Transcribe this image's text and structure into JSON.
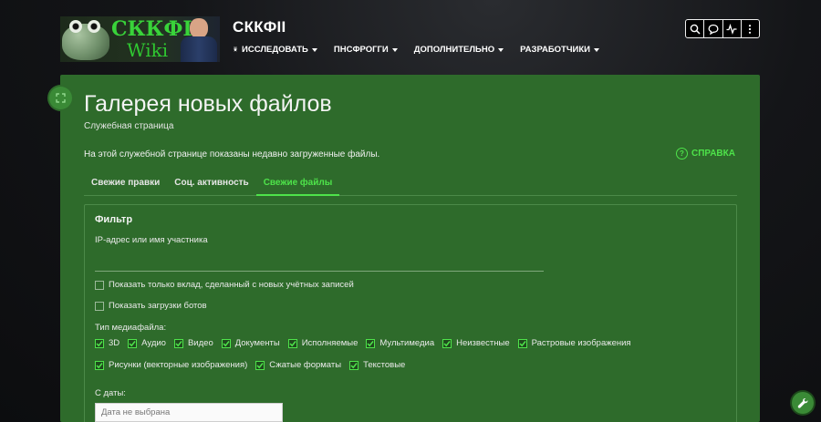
{
  "site": {
    "logo_line1": "СККФII",
    "logo_line2": "Wiki",
    "title": "СККФII"
  },
  "nav": {
    "items": [
      {
        "label": "Исследовать",
        "icon": "compass-icon"
      },
      {
        "label": "ПНСФрогги"
      },
      {
        "label": "Дополнительно"
      },
      {
        "label": "Разработчики"
      }
    ]
  },
  "toolbar": {
    "buttons": [
      "search-icon",
      "chat-icon",
      "activity-icon",
      "more-vertical-icon"
    ]
  },
  "page": {
    "title": "Галерея новых файлов",
    "subtitle": "Служебная страница",
    "intro": "На этой служебной странице показаны недавно загруженные файлы.",
    "help_label": "Справка",
    "help_icon": "?"
  },
  "tabs": [
    {
      "label": "Свежие правки",
      "active": false
    },
    {
      "label": "Соц. активность",
      "active": false
    },
    {
      "label": "Свежие файлы",
      "active": true
    }
  ],
  "filter": {
    "title": "Фильтр",
    "ip_label": "IP-адрес или имя участника",
    "ip_value": "",
    "new_accounts_label": "Показать только вклад, сделанный с новых учётных записей",
    "new_accounts_checked": false,
    "bots_label": "Показать загрузки ботов",
    "bots_checked": false,
    "media_label": "Тип медиафайла:",
    "media_types_row1": [
      {
        "label": "3D",
        "checked": true
      },
      {
        "label": "Аудио",
        "checked": true
      },
      {
        "label": "Видео",
        "checked": true
      },
      {
        "label": "Документы",
        "checked": true
      },
      {
        "label": "Исполняемые",
        "checked": true
      },
      {
        "label": "Мультимедиа",
        "checked": true
      },
      {
        "label": "Неизвестные",
        "checked": true
      },
      {
        "label": "Растровые изображения",
        "checked": true
      }
    ],
    "media_types_row2": [
      {
        "label": "Рисунки (векторные изображения)",
        "checked": true
      },
      {
        "label": "Сжатые форматы",
        "checked": true
      },
      {
        "label": "Текстовые",
        "checked": true
      }
    ],
    "date_label": "С даты:",
    "date_placeholder": "Дата не выбрана"
  },
  "colors": {
    "accent": "#4ee34a",
    "content_bg": "#2e6b2b",
    "logo_text": "#39d33a"
  }
}
